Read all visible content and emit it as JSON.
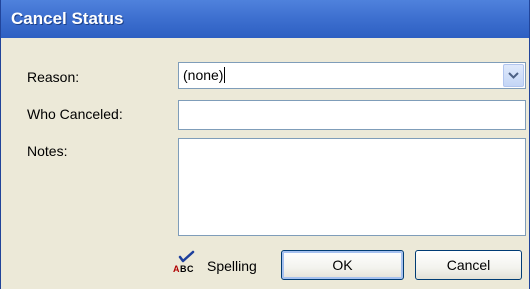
{
  "dialog": {
    "title": "Cancel Status"
  },
  "form": {
    "reason_label": "Reason:",
    "reason_value": "(none)",
    "who_label": "Who Canceled:",
    "who_value": "",
    "notes_label": "Notes:",
    "notes_value": ""
  },
  "footer": {
    "spelling_label": "Spelling",
    "spelling_icon": "spell-check-icon",
    "ok_label": "OK",
    "cancel_label": "Cancel"
  },
  "colors": {
    "titlebar": "#3d6fcf",
    "panel": "#ece9d8",
    "field_border": "#7f9db9"
  }
}
